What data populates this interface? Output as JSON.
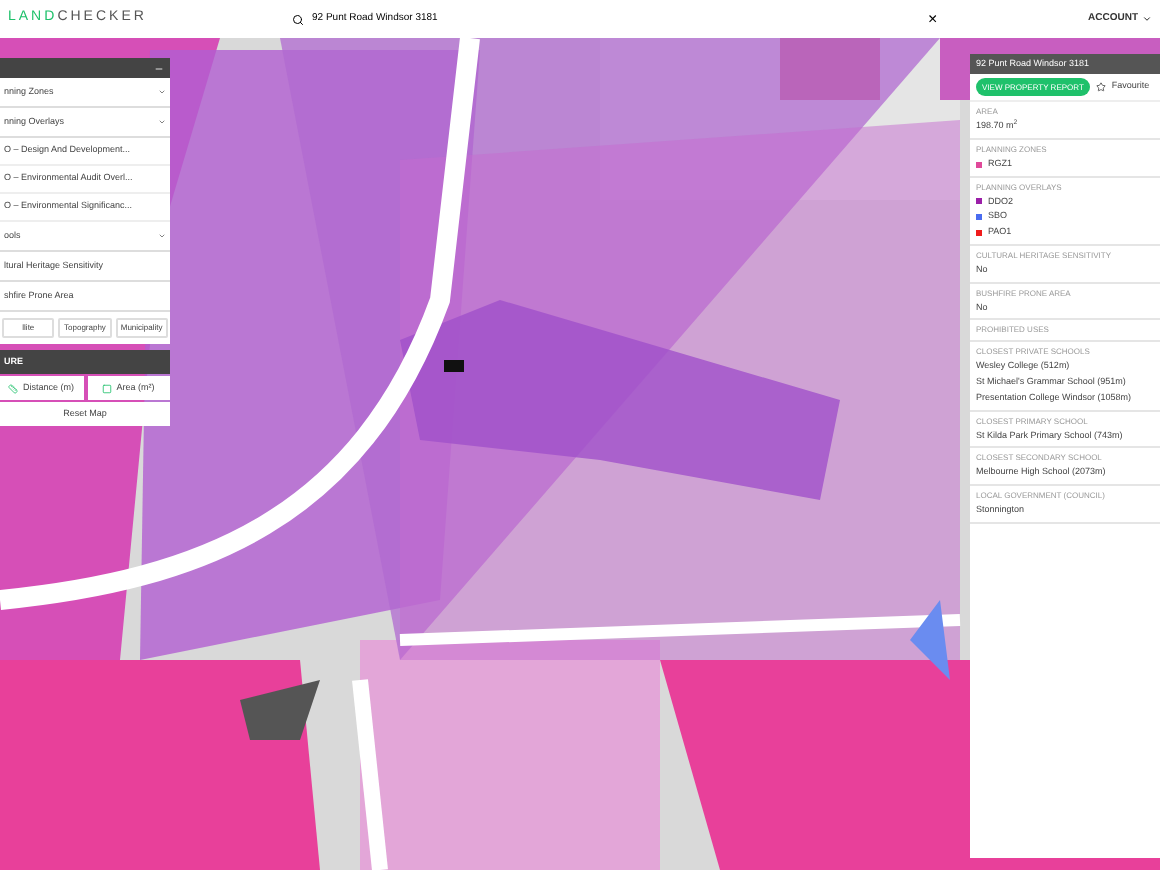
{
  "header": {
    "logo_first": "LAND",
    "logo_second": "CHECKER",
    "search": {
      "value": "92 Punt Road Windsor 3181"
    },
    "clear": "×",
    "account": "ACCOUNT"
  },
  "layers_panel": {
    "items": [
      {
        "kind": "dropdown",
        "label": "nning Zones"
      },
      {
        "kind": "dropdown",
        "label": "nning Overlays"
      },
      {
        "kind": "sub",
        "label": "O – Design And Development..."
      },
      {
        "kind": "sub",
        "label": "O – Environmental Audit Overl..."
      },
      {
        "kind": "sub",
        "label": "O – Environmental Significanc..."
      },
      {
        "kind": "dropdown",
        "label": "ools"
      },
      {
        "kind": "plain",
        "label": "ltural Heritage Sensitivity"
      },
      {
        "kind": "plain",
        "label": "shfire Prone Area"
      }
    ],
    "basemaps": [
      {
        "label": "llite"
      },
      {
        "label": "Topography"
      },
      {
        "label": "Municipality"
      }
    ]
  },
  "measure_panel": {
    "title": "URE",
    "tools": [
      {
        "kind": "distance",
        "label": "Distance (m)"
      },
      {
        "kind": "area",
        "label": "Area (m²)"
      }
    ],
    "reset": "Reset Map"
  },
  "property_panel": {
    "address": "92 Punt Road Windsor 3181",
    "report_button": "VIEW PROPERTY REPORT",
    "favourite": "Favourite",
    "sections": [
      {
        "title": "AREA",
        "lines": [
          {
            "text": "198.70 m$^{2}$"
          }
        ]
      },
      {
        "title": "PLANNING ZONES",
        "lines": [
          {
            "text": "RGZ1",
            "color": "#e0499a"
          }
        ]
      },
      {
        "title": "PLANNING OVERLAYS",
        "lines": [
          {
            "text": "DDO2",
            "color": "#9b1fa8"
          },
          {
            "text": "SBO",
            "color": "#4a6cf0"
          },
          {
            "text": "PAO1",
            "color": "#f01c1c"
          }
        ]
      },
      {
        "title": "CULTURAL HERITAGE SENSITIVITY",
        "lines": [
          {
            "text": "No"
          }
        ]
      },
      {
        "title": "BUSHFIRE PRONE AREA",
        "lines": [
          {
            "text": "No"
          }
        ]
      },
      {
        "title": "PROHIBITED USES"
      },
      {
        "title": "CLOSEST PRIVATE SCHOOLS",
        "lines": [
          {
            "text": "Wesley College (512m)"
          },
          {
            "text": "St Michael's Grammar School (951m)"
          },
          {
            "text": "Presentation College Windsor (1058m)"
          }
        ]
      },
      {
        "title": "CLOSEST PRIMARY SCHOOL",
        "lines": [
          {
            "text": "St Kilda Park Primary School (743m)"
          }
        ]
      },
      {
        "title": "CLOSEST SECONDARY SCHOOL",
        "lines": [
          {
            "text": "Melbourne High School (2073m)"
          }
        ]
      },
      {
        "title": "LOCAL GOVERNMENT (COUNCIL)",
        "lines": [
          {
            "text": "Stonnington"
          }
        ]
      }
    ]
  }
}
